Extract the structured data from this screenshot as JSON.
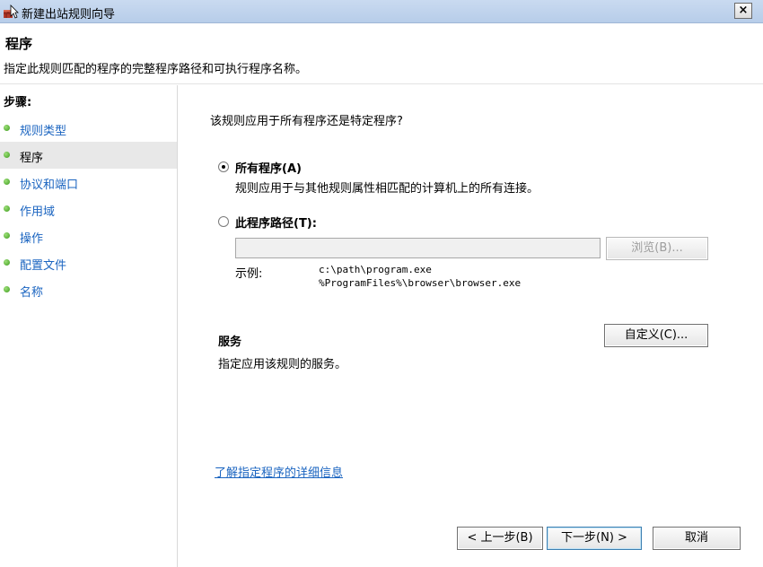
{
  "window": {
    "title": "新建出站规则向导",
    "close_label": "×"
  },
  "header": {
    "title": "程序",
    "description": "指定此规则匹配的程序的完整程序路径和可执行程序名称。"
  },
  "sidebar": {
    "title": "步骤:",
    "items": [
      {
        "label": "规则类型",
        "current": false
      },
      {
        "label": "程序",
        "current": true
      },
      {
        "label": "协议和端口",
        "current": false
      },
      {
        "label": "作用域",
        "current": false
      },
      {
        "label": "操作",
        "current": false
      },
      {
        "label": "配置文件",
        "current": false
      },
      {
        "label": "名称",
        "current": false
      }
    ]
  },
  "main": {
    "question": "该规则应用于所有程序还是特定程序?",
    "option_all": {
      "label": "所有程序(A)",
      "description": "规则应用于与其他规则属性相匹配的计算机上的所有连接。",
      "selected": true
    },
    "option_path": {
      "label": "此程序路径(T):",
      "selected": false,
      "input_value": "",
      "browse_label": "浏览(B)..."
    },
    "example": {
      "label": "示例:",
      "lines": [
        "c:\\path\\program.exe",
        "%ProgramFiles%\\browser\\browser.exe"
      ]
    },
    "services": {
      "title": "服务",
      "description": "指定应用该规则的服务。",
      "customize_label": "自定义(C)..."
    },
    "learn_more_link": "了解指定程序的详细信息"
  },
  "footer": {
    "back_label": "< 上一步(B)",
    "next_label": "下一步(N) >",
    "cancel_label": "取消"
  }
}
